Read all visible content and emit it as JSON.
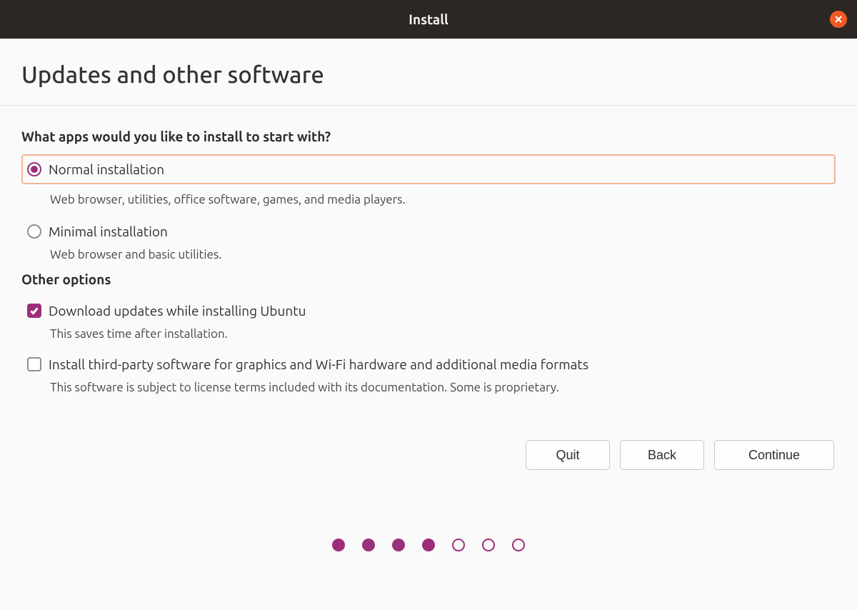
{
  "window": {
    "title": "Install"
  },
  "page": {
    "heading": "Updates and other software"
  },
  "apps": {
    "question": "What apps would you like to install to start with?",
    "normal": {
      "label": "Normal installation",
      "desc": "Web browser, utilities, office software, games, and media players.",
      "selected": true
    },
    "minimal": {
      "label": "Minimal installation",
      "desc": "Web browser and basic utilities.",
      "selected": false
    }
  },
  "other": {
    "heading": "Other options",
    "download": {
      "label": "Download updates while installing Ubuntu",
      "desc": "This saves time after installation.",
      "checked": true
    },
    "thirdparty": {
      "label": "Install third-party software for graphics and Wi-Fi hardware and additional media formats",
      "desc": "This software is subject to license terms included with its documentation. Some is proprietary.",
      "checked": false
    }
  },
  "buttons": {
    "quit": "Quit",
    "back": "Back",
    "continue": "Continue"
  },
  "progress": {
    "total": 7,
    "current": 4
  }
}
